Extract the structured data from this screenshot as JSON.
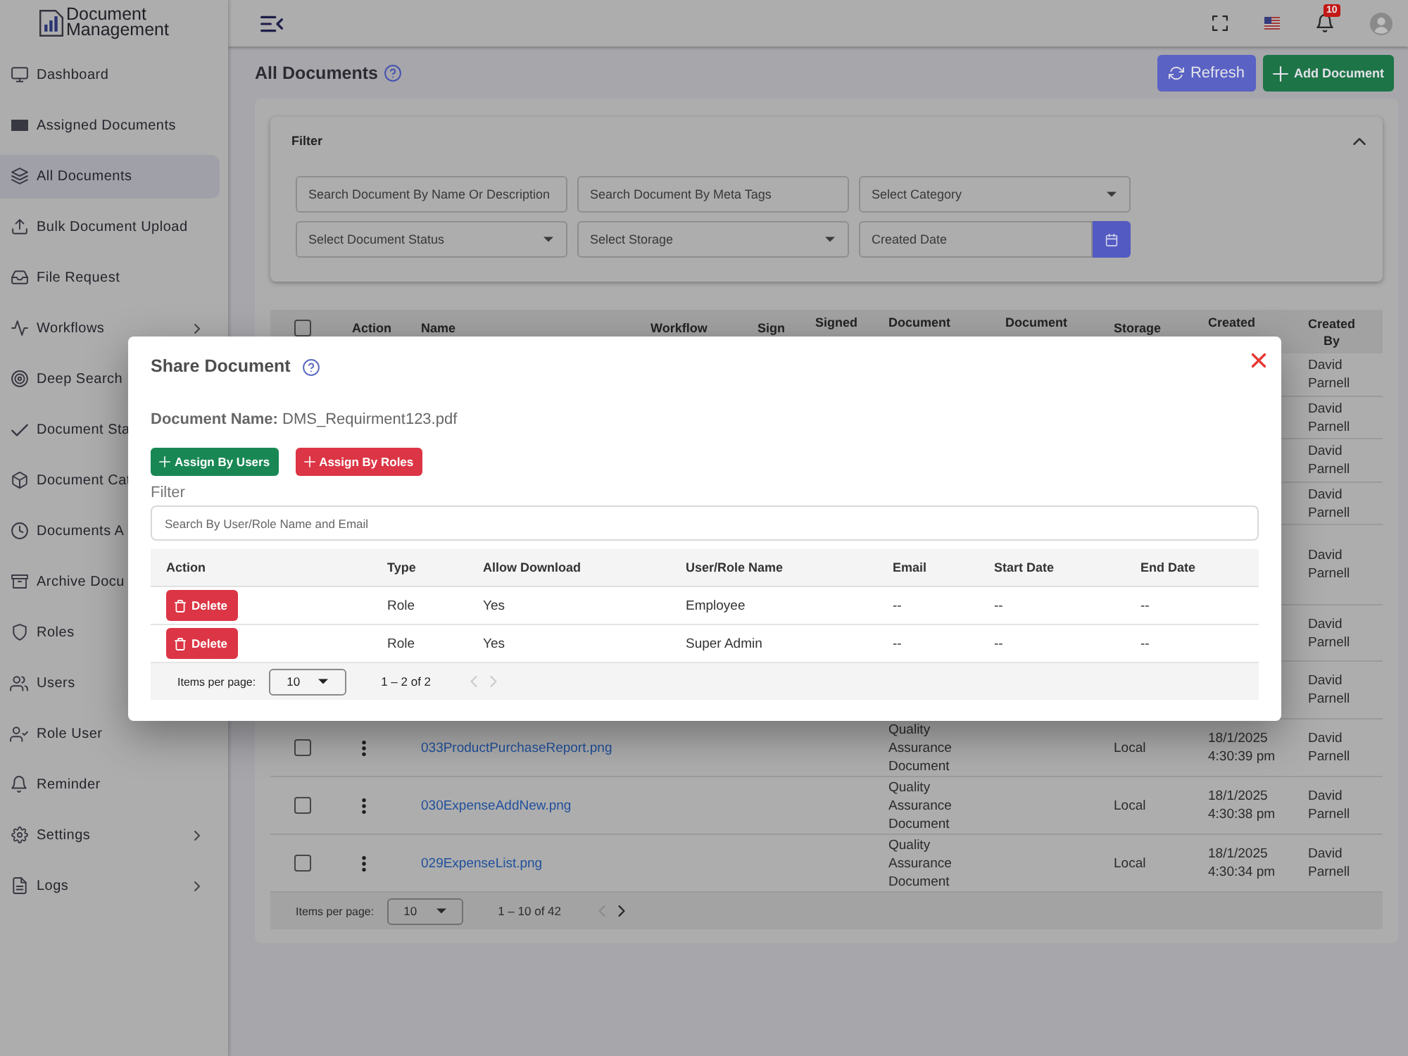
{
  "logo": {
    "text": "Document Management"
  },
  "sidebar": {
    "items": [
      {
        "label": "Dashboard",
        "selected": false,
        "submenu": false
      },
      {
        "label": "Assigned Documents",
        "selected": false,
        "submenu": false
      },
      {
        "label": "All Documents",
        "selected": true,
        "submenu": false
      },
      {
        "label": "Bulk Document Upload",
        "selected": false,
        "submenu": false
      },
      {
        "label": "File Request",
        "selected": false,
        "submenu": false
      },
      {
        "label": "Workflows",
        "selected": false,
        "submenu": true
      },
      {
        "label": "Deep Search",
        "selected": false
      },
      {
        "label": "Document Sta",
        "selected": false
      },
      {
        "label": "Document Cat",
        "selected": false
      },
      {
        "label": "Documents A",
        "selected": false
      },
      {
        "label": "Archive Docu",
        "selected": false
      },
      {
        "label": "Roles",
        "selected": false
      },
      {
        "label": "Users",
        "selected": false
      },
      {
        "label": "Role User",
        "selected": false,
        "submenu": false
      },
      {
        "label": "Reminder",
        "selected": false,
        "submenu": false
      },
      {
        "label": "Settings",
        "selected": false,
        "submenu": true
      },
      {
        "label": "Logs",
        "selected": false,
        "submenu": true
      }
    ]
  },
  "top_bar": {
    "notification_count": "10"
  },
  "page": {
    "title": "All Documents",
    "buttons": [
      {
        "label": "Refresh",
        "kind": "refresh"
      },
      {
        "label": "Add Document",
        "kind": "add"
      }
    ]
  },
  "filter": {
    "title": "Filter",
    "expanded": true,
    "fields": [
      {
        "kind": "text",
        "placeholder": "Search Document By Name Or Description"
      },
      {
        "kind": "text",
        "placeholder": "Search Document By Meta Tags"
      },
      {
        "kind": "select",
        "placeholder": "Select Category"
      },
      {
        "kind": "select",
        "placeholder": "Select Document Status"
      },
      {
        "kind": "select",
        "placeholder": "Select Storage"
      },
      {
        "kind": "date",
        "placeholder": "Created Date"
      }
    ]
  },
  "table": {
    "select_all": {
      "checked": false
    },
    "columns": [
      "Action",
      "Name",
      "Workflow",
      "Sign",
      "Signed",
      "Document",
      "Document",
      "Storage",
      "Created",
      "Created By"
    ],
    "rows": [
      {
        "created_by": "David Parnell"
      },
      {
        "created_by": "David Parnell"
      },
      {
        "created_by": "David Parnell"
      },
      {
        "created_by": "David Parnell"
      },
      {
        "created_by": "David Parnell"
      },
      {
        "created_by": "David Parnell"
      },
      {
        "created_by": "David Parnell"
      },
      {
        "checked": false,
        "name": "033ProductPurchaseReport.png",
        "document": "Quality Assurance Document",
        "storage": "Local",
        "created": "18/1/2025 4:30:39 pm",
        "created_by": "David Parnell"
      },
      {
        "checked": false,
        "name": "030ExpenseAddNew.png",
        "document": "Quality Assurance Document",
        "storage": "Local",
        "created": "18/1/2025 4:30:38 pm",
        "created_by": "David Parnell"
      },
      {
        "checked": false,
        "name": "029ExpenseList.png",
        "document": "Quality Assurance Document",
        "storage": "Local",
        "created": "18/1/2025 4:30:34 pm",
        "created_by": "David Parnell"
      }
    ]
  },
  "pagination": {
    "label": "Items per page:",
    "page_size": "10",
    "range": "1 – 10 of 42",
    "prev_disabled": true,
    "next_disabled": false
  },
  "share_dialog": {
    "title": "Share Document",
    "document_name": "**Document Name:** DMS_Requirment123.pdf",
    "buttons": [
      {
        "label": "Assign By Users",
        "kind": "success"
      },
      {
        "label": "Assign By Roles",
        "kind": "danger"
      }
    ],
    "filter_label": "Filter",
    "search": {
      "placeholder": "Search By User/Role Name and Email"
    },
    "columns": [
      "Action",
      "Type",
      "Allow Download",
      "User/Role Name",
      "Email",
      "Start Date",
      "End Date"
    ],
    "rows": [
      {
        "action": "Delete",
        "type": "Role",
        "allow_download": "Yes",
        "name": "Employee",
        "email": "--",
        "start_date": "--",
        "end_date": "--"
      },
      {
        "action": "Delete",
        "type": "Role",
        "allow_download": "Yes",
        "name": "Super Admin",
        "email": "--",
        "start_date": "--",
        "end_date": "--"
      }
    ],
    "pagination": {
      "label": "Items per page:",
      "page_size": "10",
      "range": "1 – 2 of 2",
      "prev_disabled": true,
      "next_disabled": true
    }
  }
}
